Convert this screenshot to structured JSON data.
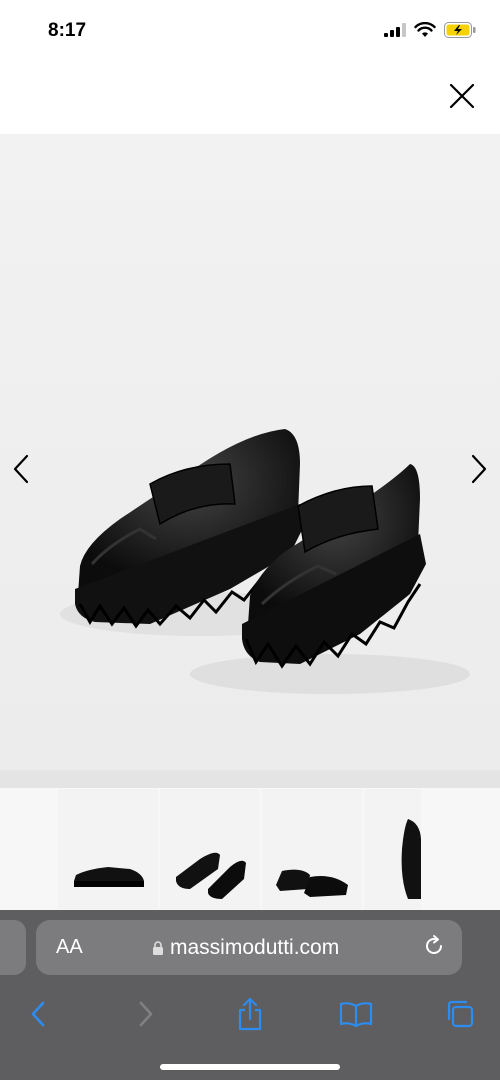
{
  "status": {
    "time": "8:17"
  },
  "header": {
    "close_icon": "close-icon"
  },
  "gallery": {
    "prev_icon": "chevron-left-icon",
    "next_icon": "chevron-right-icon"
  },
  "thumbnails": [
    "loafer-side-view",
    "loafer-pair-front",
    "loafer-pair-rear",
    "loafer-cropped"
  ],
  "browser": {
    "text_size_label": "AA",
    "url": "massimodutti.com",
    "lock_icon": "lock-icon",
    "reload_icon": "reload-icon",
    "toolbar_icons": [
      "back-icon",
      "forward-icon",
      "share-icon",
      "bookmarks-icon",
      "tabs-icon"
    ]
  },
  "colors": {
    "toolbar_bg": "#5e5e60",
    "accent": "#1e90ff",
    "battery": "#f5d200"
  }
}
